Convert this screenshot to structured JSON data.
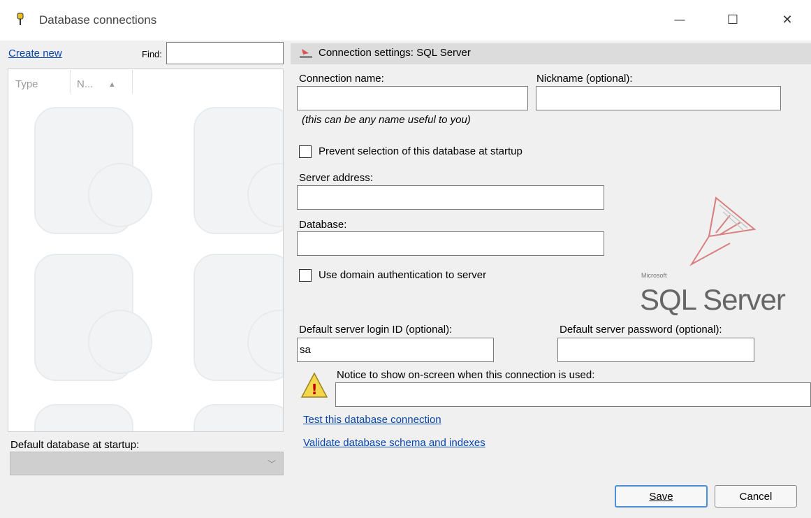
{
  "window": {
    "title": "Database connections",
    "minimize_glyph": "—",
    "maximize_glyph": "☐",
    "close_glyph": "✕"
  },
  "left_panel": {
    "create_new": "Create new",
    "find_label": "Find:",
    "find_value": "",
    "columns": [
      "Type",
      "N...",
      "▲"
    ],
    "default_db_label": "Default database at startup:",
    "default_db_value": "",
    "default_db_arrow": "﹀"
  },
  "settings": {
    "title": "Connection settings: SQL Server",
    "connection_name_label": "Connection name:",
    "connection_name_value": "",
    "connection_name_hint": "(this can be any name useful to you)",
    "nickname_label": "Nickname (optional):",
    "nickname_value": "",
    "prevent_selection_label": "Prevent selection of this database at startup",
    "server_address_label": "Server address:",
    "server_address_value": "",
    "database_label": "Database:",
    "database_value": "",
    "domain_auth_label": "Use domain authentication to server",
    "login_label": "Default server login ID (optional):",
    "login_value": "sa",
    "password_label": "Default server password (optional):",
    "password_value": "",
    "notice_label": "Notice to show on-screen when this connection is used:",
    "notice_value": "",
    "test_link": "Test this database connection",
    "validate_link": "Validate database schema and indexes",
    "logo_small": "Microsoft",
    "logo_big": "SQL Server",
    "warning_glyph": "!"
  },
  "buttons": {
    "save": "Save",
    "cancel": "Cancel"
  }
}
